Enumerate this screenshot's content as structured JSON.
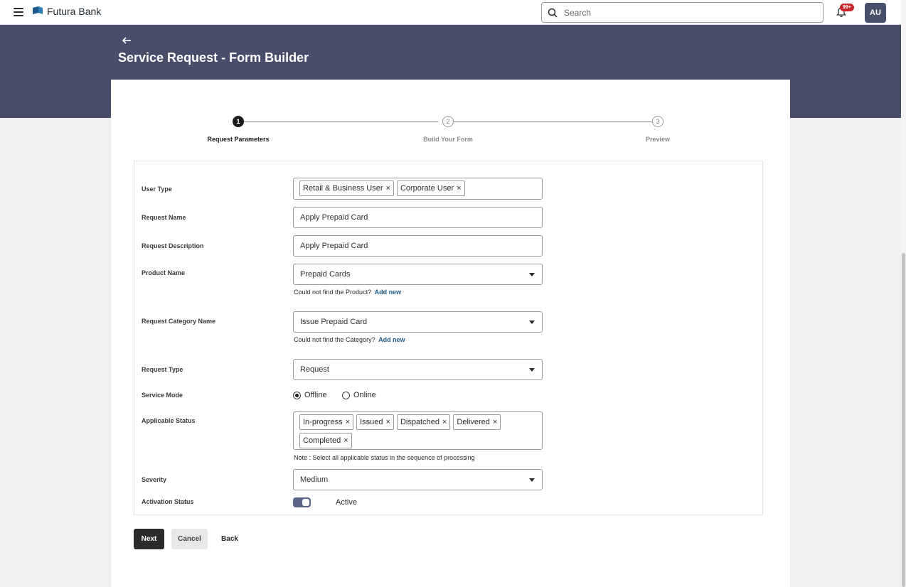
{
  "topbar": {
    "brand": "Futura Bank",
    "search_placeholder": "Search",
    "notification_badge": "99+",
    "avatar_initials": "AU"
  },
  "page": {
    "title": "Service Request - Form Builder"
  },
  "stepper": {
    "steps": [
      {
        "number": "1",
        "label": "Request Parameters",
        "state": "active"
      },
      {
        "number": "2",
        "label": "Build Your Form",
        "state": "inactive"
      },
      {
        "number": "3",
        "label": "Preview",
        "state": "inactive"
      }
    ]
  },
  "form": {
    "user_type": {
      "label": "User Type",
      "chips": [
        "Retail & Business User",
        "Corporate User"
      ]
    },
    "request_name": {
      "label": "Request Name",
      "value": "Apply Prepaid Card"
    },
    "request_description": {
      "label": "Request Description",
      "value": "Apply Prepaid Card"
    },
    "product_name": {
      "label": "Product Name",
      "value": "Prepaid Cards",
      "helper_text": "Could not find the Product?",
      "helper_link": "Add new"
    },
    "request_category": {
      "label": "Request Category Name",
      "value": "Issue Prepaid Card",
      "helper_text": "Could not find the Category?",
      "helper_link": "Add new"
    },
    "request_type": {
      "label": "Request Type",
      "value": "Request"
    },
    "service_mode": {
      "label": "Service Mode",
      "options": [
        "Offline",
        "Online"
      ],
      "selected": "Offline"
    },
    "applicable_status": {
      "label": "Applicable Status",
      "chips": [
        "In-progress",
        "Issued",
        "Dispatched",
        "Delivered",
        "Completed"
      ],
      "note": "Note : Select all applicable status in the sequence of processing"
    },
    "severity": {
      "label": "Severity",
      "value": "Medium"
    },
    "activation_status": {
      "label": "Activation Status",
      "value": "Active",
      "on": true
    }
  },
  "actions": {
    "next": "Next",
    "cancel": "Cancel",
    "back": "Back"
  },
  "colors": {
    "banner": "#484d6a",
    "primary_button": "#2c2b29",
    "link": "#1e5b8c",
    "badge": "#c8262b",
    "toggle": "#5a6488"
  }
}
